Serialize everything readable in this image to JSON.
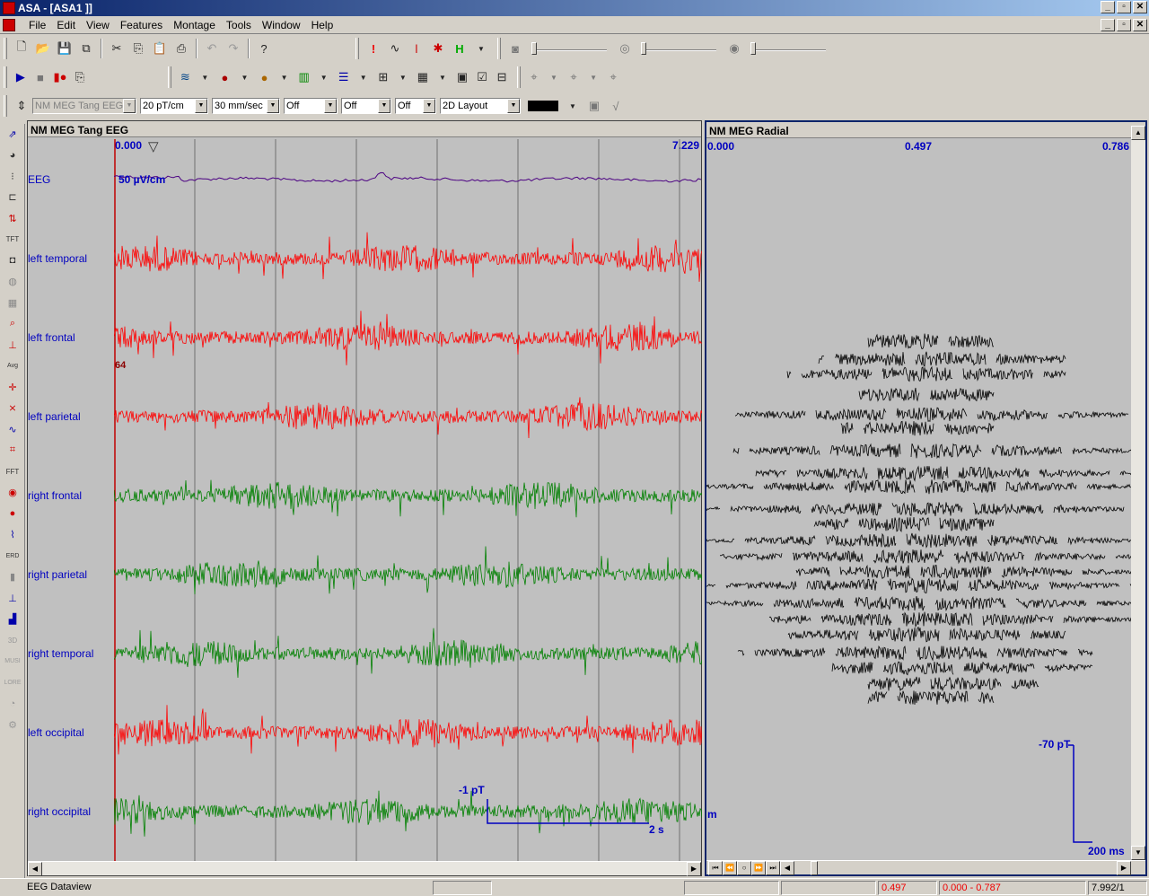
{
  "window": {
    "title": "ASA - [ASA1                           ]]",
    "buttons": [
      "_",
      "▫",
      "✕"
    ]
  },
  "menu": {
    "items": [
      "File",
      "Edit",
      "View",
      "Features",
      "Montage",
      "Tools",
      "Window",
      "Help"
    ]
  },
  "toolbar3": {
    "montage": "NM MEG Tang EEG (c",
    "scale": "20 pT/cm",
    "speed": "30 mm/sec",
    "filter1": "Off",
    "filter2": "Off",
    "filter3": "Off",
    "layout": "2D Layout"
  },
  "left_panel": {
    "title": "NM MEG Tang EEG",
    "time_start": "0.000",
    "time_end": "7.229",
    "eeg_scale": "50 µV/cm",
    "marker": "64",
    "scale_bar_y": "-1 pT",
    "scale_bar_x": "2 s",
    "channels": [
      {
        "label": "EEG",
        "color": "#4b0082"
      },
      {
        "label": "left temporal",
        "color": "#ff0000"
      },
      {
        "label": "left frontal",
        "color": "#ff0000"
      },
      {
        "label": "left parietal",
        "color": "#ff0000"
      },
      {
        "label": "right frontal",
        "color": "#008000"
      },
      {
        "label": "right parietal",
        "color": "#008000"
      },
      {
        "label": "right temporal",
        "color": "#008000"
      },
      {
        "label": "left occipital",
        "color": "#ff0000"
      },
      {
        "label": "right occipital",
        "color": "#008000"
      }
    ]
  },
  "right_panel": {
    "title": "NM MEG Radial",
    "time_start": "0.000",
    "time_mid": "0.497",
    "time_end": "0.786",
    "scale_bar_y": "-70 pT",
    "scale_bar_x": "200 ms",
    "edge_mark": "m"
  },
  "status": {
    "view": "EEG Dataview",
    "cursor": "0.497",
    "range": "0.000 - 0.787",
    "page": "7.992/1"
  }
}
